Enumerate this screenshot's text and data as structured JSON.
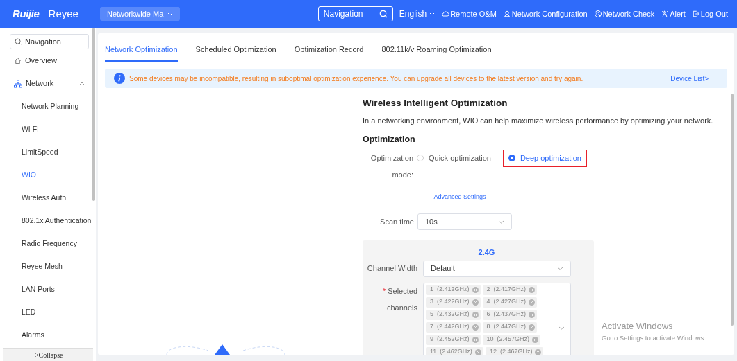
{
  "header": {
    "logo": {
      "brand": "Ruijie",
      "sub_brand": "Reyee"
    },
    "project_selector": "Networkwide Ma",
    "search": {
      "placeholder": "Navigation"
    },
    "menu": [
      {
        "kind": "language",
        "label": "English"
      },
      {
        "kind": "cloud",
        "label": "Remote O&M"
      },
      {
        "kind": "config",
        "label": "Network Configuration"
      },
      {
        "kind": "check",
        "label": "Network Check"
      },
      {
        "kind": "alert",
        "label": "Alert"
      },
      {
        "kind": "logout",
        "label": "Log Out"
      }
    ]
  },
  "sidebar": {
    "search": {
      "placeholder": "Navigation"
    },
    "items": [
      {
        "kind": "home",
        "label": "Overview",
        "selected": false
      },
      {
        "kind": "network",
        "label": "Network",
        "selected": false,
        "expanded": true,
        "children": [
          {
            "label": "Network Planning",
            "selected": false
          },
          {
            "label": "Wi-Fi",
            "selected": false
          },
          {
            "label": "LimitSpeed",
            "selected": false
          },
          {
            "label": "WIO",
            "selected": true
          },
          {
            "label": "Wireless Auth",
            "selected": false
          },
          {
            "label": "802.1x Authentication",
            "selected": false
          },
          {
            "label": "Radio Frequency",
            "selected": false
          },
          {
            "label": "Reyee Mesh",
            "selected": false
          },
          {
            "label": "LAN Ports",
            "selected": false
          },
          {
            "label": "LED",
            "selected": false
          },
          {
            "label": "Alarms",
            "selected": false
          }
        ]
      }
    ],
    "collapse": "Collapse"
  },
  "tabs": [
    {
      "label": "Network Optimization",
      "selected": true
    },
    {
      "label": "Scheduled Optimization",
      "selected": false
    },
    {
      "label": "Optimization Record",
      "selected": false
    },
    {
      "label": "802.11k/v Roaming Optimization",
      "selected": false
    }
  ],
  "notice": {
    "text": "Some devices may be incompatible, resulting in suboptimal optimization experience. You can upgrade all devices to the latest version and try again.",
    "link": "Device List>"
  },
  "form": {
    "title": "Wireless Intelligent Optimization",
    "description": "In a networking environment, WIO can help maximize wireless performance by optimizing your network.",
    "section": "Optimization",
    "mode": {
      "label": "Optimization mode:",
      "options": [
        {
          "label": "Quick optimization",
          "selected": false,
          "highlighted": false
        },
        {
          "label": "Deep optimization",
          "selected": true,
          "highlighted": true
        }
      ]
    },
    "advanced_divider": "Advanced Settings",
    "scan_time": {
      "label": "Scan time",
      "value": "10s"
    },
    "band": {
      "title": "2.4G",
      "channel_width": {
        "label": "Channel Width",
        "value": "Default"
      },
      "selected_channels": {
        "label": "Selected channels",
        "required_mark": "*",
        "chips": [
          "1  (2.412GHz)",
          "2  (2.417GHz)",
          "3  (2.422GHz)",
          "4  (2.427GHz)",
          "5  (2.432GHz)",
          "6  (2.437GHz)",
          "7  (2.442GHz)",
          "8  (2.447GHz)",
          "9  (2.452GHz)",
          "10  (2.457GHz)",
          "11  (2.462GHz)",
          "12  (2.467GHz)"
        ]
      }
    }
  },
  "os_overlay": {
    "title": "Activate Windows",
    "subtitle": "Go to Settings to activate Windows."
  }
}
